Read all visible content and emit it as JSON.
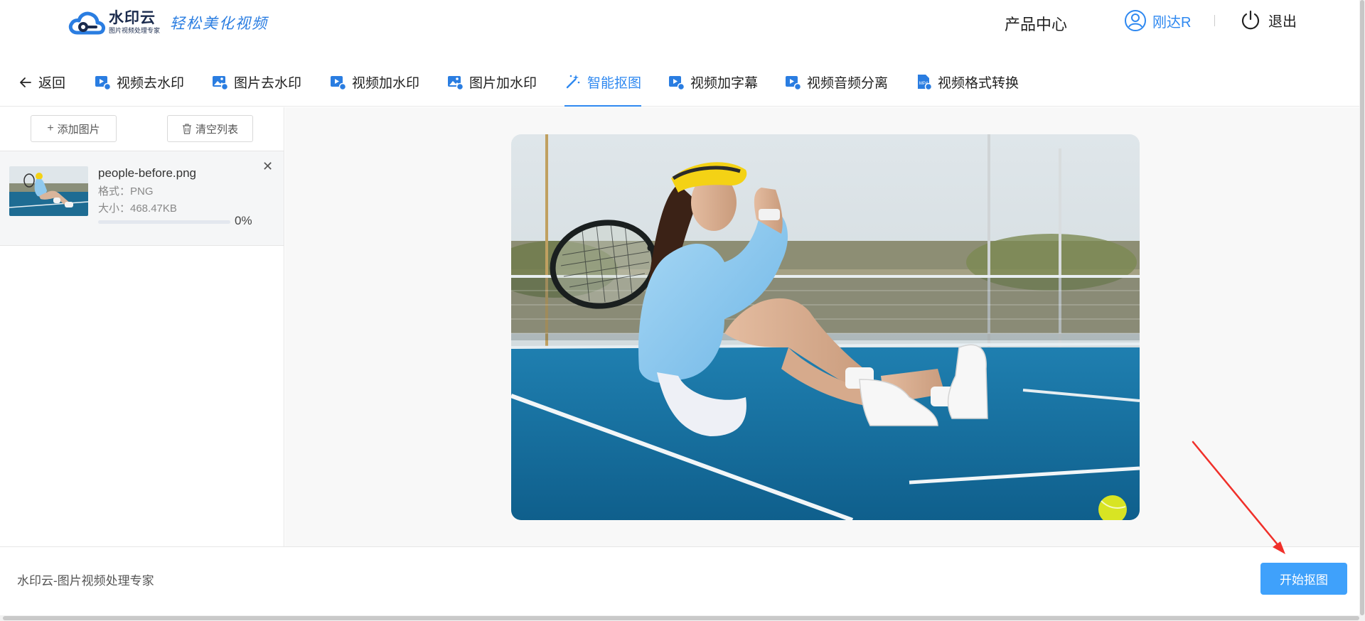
{
  "header": {
    "logo_name": "水印云",
    "logo_sub": "图片视频处理专家",
    "slogan": "轻松美化视频",
    "product_center": "产品中心",
    "user_name": "刚达R",
    "logout": "退出"
  },
  "nav": {
    "back": "返回",
    "tabs": [
      {
        "label": "视频去水印",
        "icon": "video-icon"
      },
      {
        "label": "图片去水印",
        "icon": "image-icon"
      },
      {
        "label": "视频加水印",
        "icon": "video-icon"
      },
      {
        "label": "图片加水印",
        "icon": "image-icon"
      },
      {
        "label": "智能抠图",
        "icon": "magic-wand-icon",
        "active": true
      },
      {
        "label": "视频加字幕",
        "icon": "video-icon"
      },
      {
        "label": "视频音频分离",
        "icon": "video-icon"
      },
      {
        "label": "视频格式转换",
        "icon": "mp4-file-icon"
      }
    ]
  },
  "leftpanel": {
    "add_label": "添加图片",
    "clear_label": "清空列表",
    "file": {
      "name": "people-before.png",
      "format": "格式：PNG",
      "size": "大小：468.47KB",
      "progress": 0,
      "progress_text": "0%"
    }
  },
  "footer": {
    "text": "水印云-图片视频处理专家",
    "start_label": "开始抠图"
  },
  "colors": {
    "accent": "#2e88f0",
    "button": "#3fa1fb",
    "annotation_arrow": "#f0302a"
  }
}
